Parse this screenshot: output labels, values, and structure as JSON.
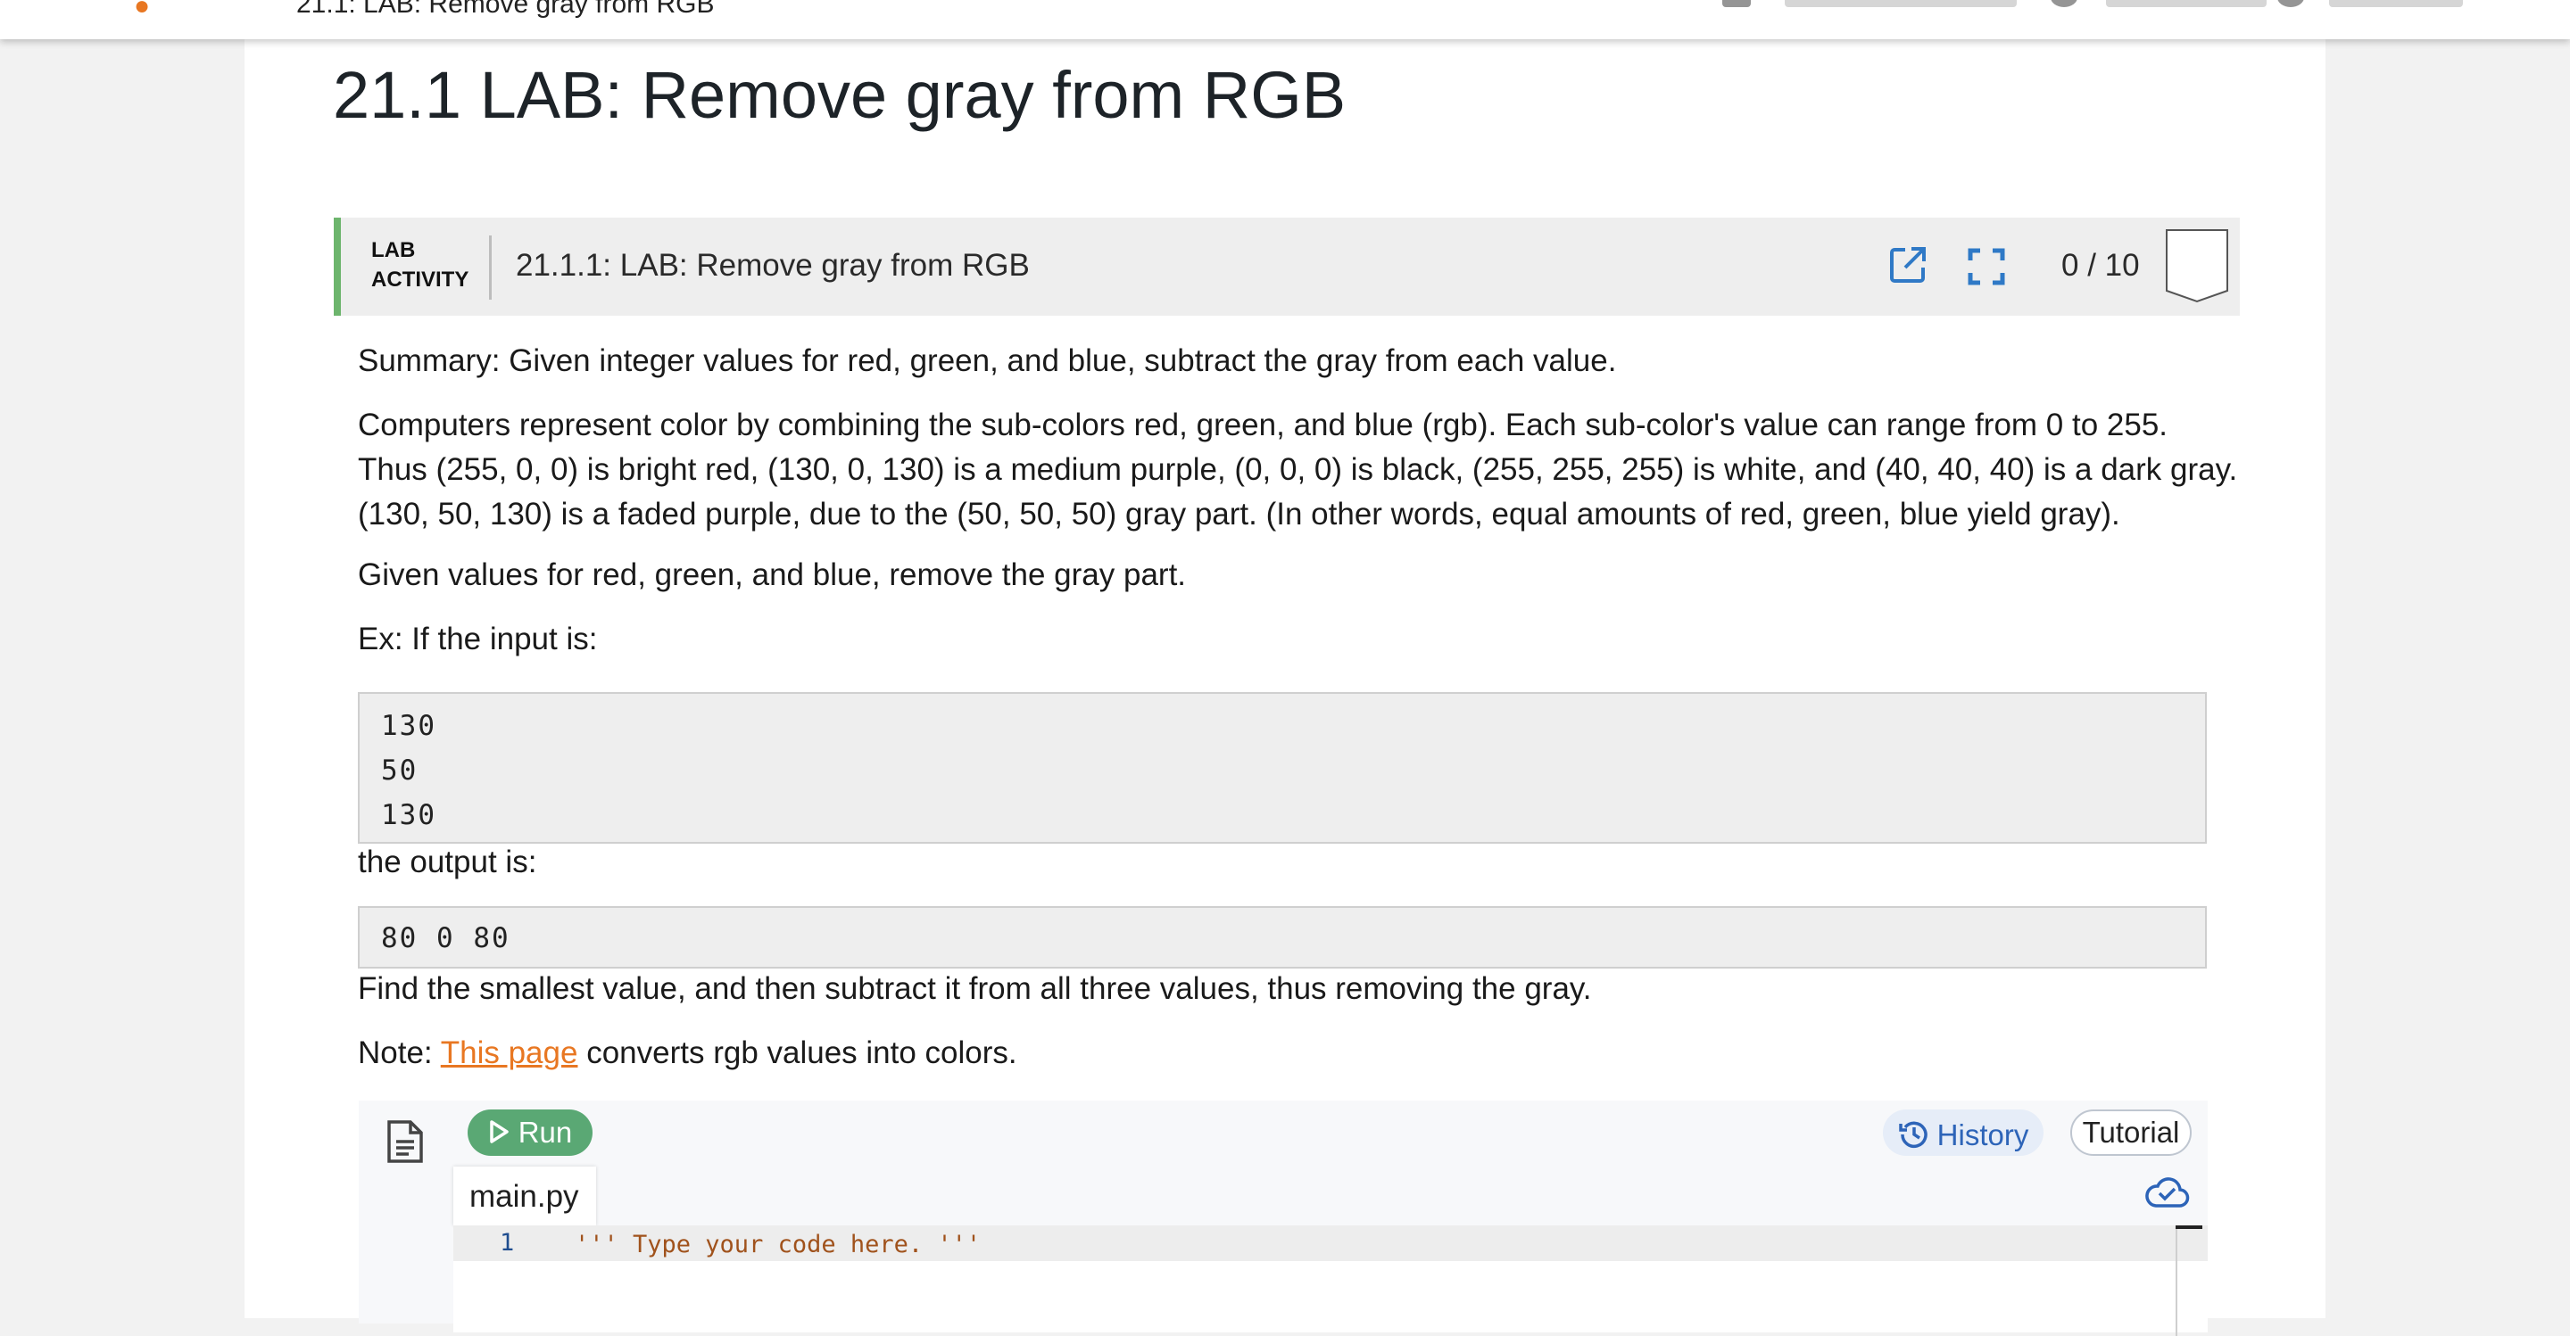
{
  "topbar": {
    "breadcrumb": "21.1: LAB: Remove gray from RGB"
  },
  "page": {
    "title": "21.1 LAB: Remove gray from RGB"
  },
  "activity": {
    "label_line1": "LAB",
    "label_line2": "ACTIVITY",
    "title": "21.1.1: LAB: Remove gray from RGB",
    "score": "0 / 10",
    "accent_color": "#6db56d",
    "icons": [
      "open-in-new-icon",
      "fullscreen-icon",
      "score-badge-icon"
    ]
  },
  "content": {
    "summary": "Summary: Given integer values for red, green, and blue, subtract the gray from each value.",
    "description_lines": [
      "Computers represent color by combining the sub-colors red, green, and blue (rgb). Each sub-color's value can range from 0 to 255.",
      "Thus (255, 0, 0) is bright red, (130, 0, 130) is a medium purple, (0, 0, 0) is black, (255, 255, 255) is white, and (40, 40, 40) is a dark gray.",
      "(130, 50, 130) is a faded purple, due to the (50, 50, 50) gray part. (In other words, equal amounts of red, green, blue yield gray)."
    ],
    "given": "Given values for red, green, and blue, remove the gray part.",
    "example_intro": "Ex: If the input is:",
    "example_input": [
      "130",
      "50",
      "130"
    ],
    "output_intro": "the output is:",
    "example_output": "80 0 80",
    "instruction": "Find the smallest value, and then subtract it from all three values, thus removing the gray.",
    "note_prefix": "Note: ",
    "note_link": "This page",
    "note_suffix": " converts rgb values into colors.",
    "link_color": "#e87722"
  },
  "ide": {
    "run_label": "Run",
    "history_label": "History",
    "tutorial_label": "Tutorial",
    "file_tab": "main.py",
    "line_number": "1",
    "code_line": "''' Type your code here. '''",
    "run_color": "#5aa874",
    "history_color": "#2d64b8",
    "icons": [
      "file-icon",
      "play-icon",
      "history-icon",
      "cloud-check-icon"
    ]
  }
}
